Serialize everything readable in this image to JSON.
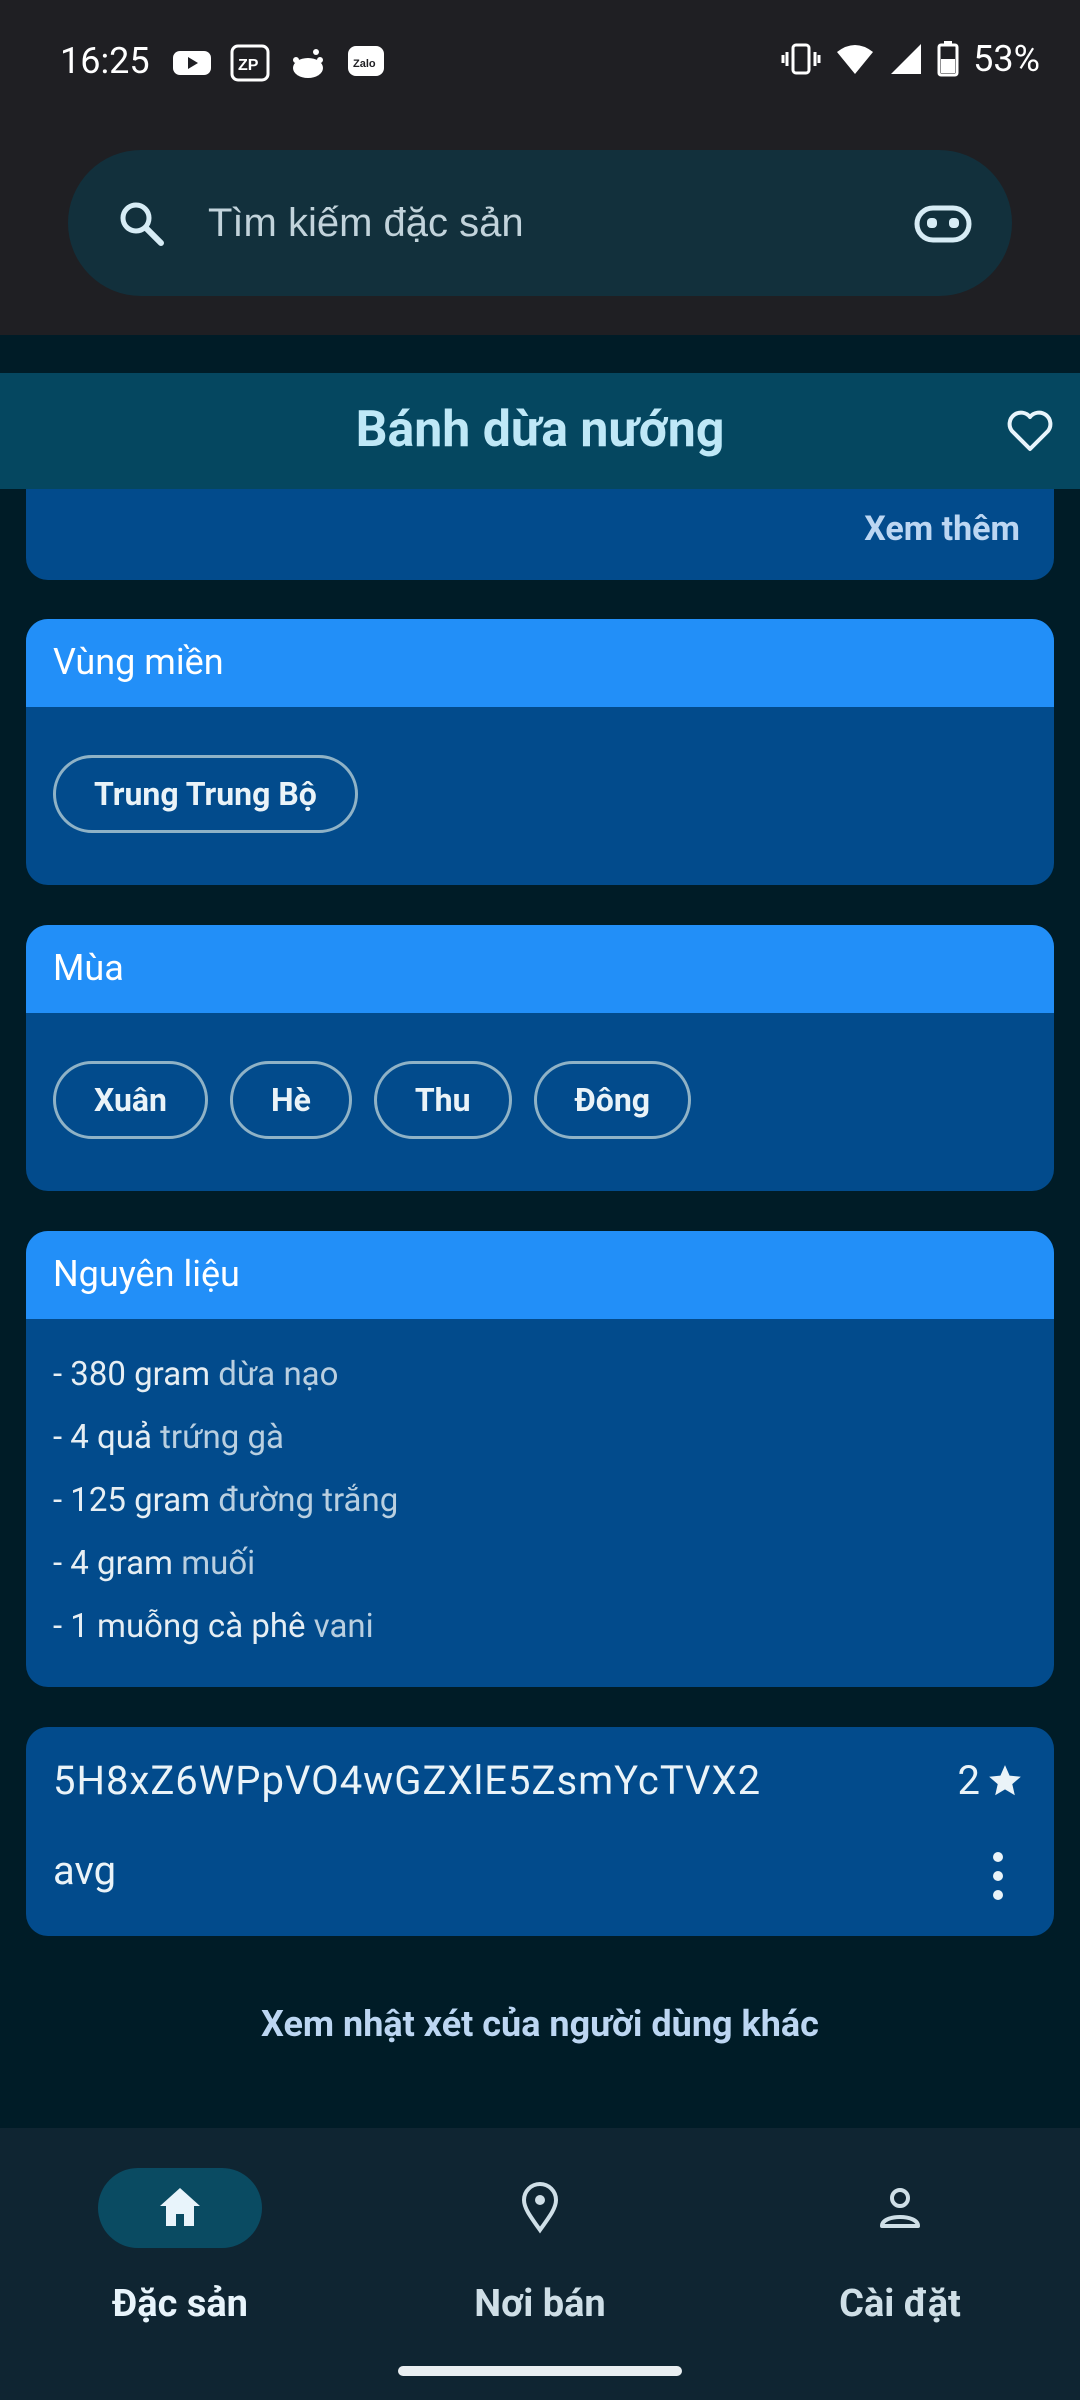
{
  "status_bar": {
    "time": "16:25",
    "battery": "53%"
  },
  "search": {
    "placeholder": "Tìm kiếm đặc sản"
  },
  "header": {
    "title": "Bánh dừa nướng"
  },
  "description_card": {
    "see_more": "Xem thêm"
  },
  "region": {
    "title": "Vùng miền",
    "chips": [
      "Trung Trung Bộ"
    ]
  },
  "season": {
    "title": "Mùa",
    "chips": [
      "Xuân",
      "Hè",
      "Thu",
      "Đông"
    ]
  },
  "ingredients": {
    "title": "Nguyên liệu",
    "items": [
      {
        "qty": "- 380 gram",
        "name": "dừa nạo"
      },
      {
        "qty": "- 4 quả",
        "name": "trứng gà"
      },
      {
        "qty": "- 125 gram",
        "name": "đường trắng"
      },
      {
        "qty": "- 4 gram",
        "name": "muối"
      },
      {
        "qty": "- 1 muỗng cà phê",
        "name": "vani"
      }
    ]
  },
  "review": {
    "user_id": "5H8xZ6WPpVO4wGZXlE5ZsmYcTVX2",
    "rating": "2",
    "name": "avg"
  },
  "other_reviews_link": "Xem nhật xét của người dùng khác",
  "nav": {
    "items": [
      {
        "label": "Đặc sản",
        "icon": "home-icon",
        "active": true
      },
      {
        "label": "Nơi bán",
        "icon": "location-pin-icon",
        "active": false
      },
      {
        "label": "Cài đặt",
        "icon": "person-icon",
        "active": false
      }
    ]
  }
}
